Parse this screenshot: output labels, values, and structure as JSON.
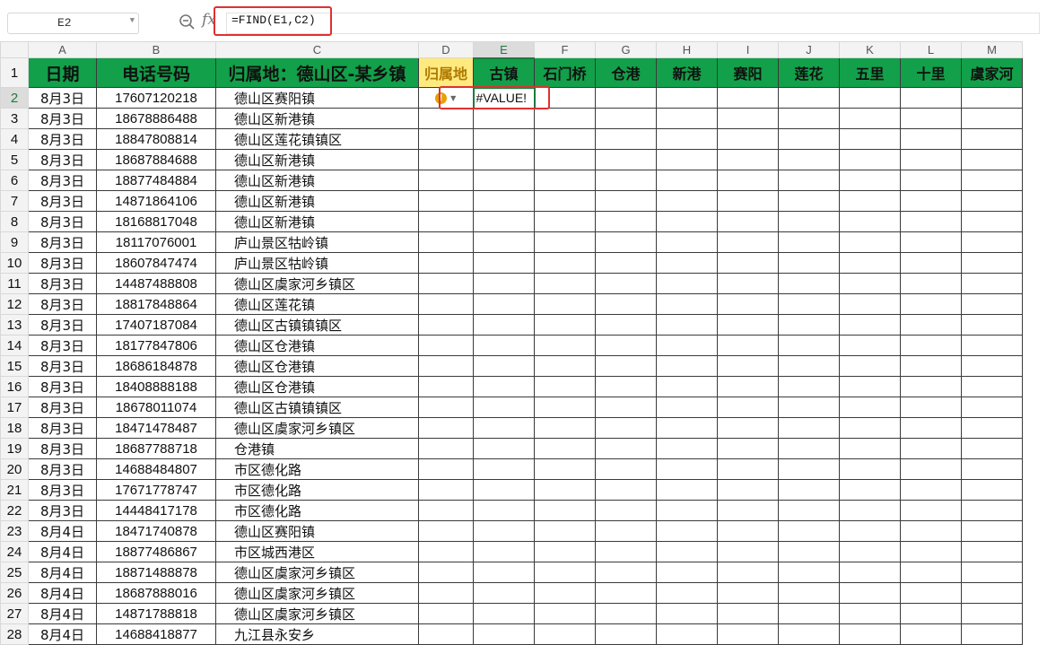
{
  "formula_bar": {
    "name_box": "E2",
    "fx_label": "fx",
    "formula": "=FIND(E1,C2)"
  },
  "columns": [
    "A",
    "B",
    "C",
    "D",
    "E",
    "F",
    "G",
    "H",
    "I",
    "J",
    "K",
    "L",
    "M"
  ],
  "header_row": {
    "row_number": "1",
    "cells": [
      "日期",
      "电话号码",
      "归属地：德山区-某乡镇",
      "归属地",
      "古镇",
      "石门桥",
      "仓港",
      "新港",
      "赛阳",
      "莲花",
      "五里",
      "十里",
      "虞家河"
    ]
  },
  "active_cell": {
    "value": "#VALUE!",
    "warning_icon": "!"
  },
  "rows": [
    {
      "n": "2",
      "date": "8月3日",
      "phone": "17607120218",
      "loc": "德山区赛阳镇"
    },
    {
      "n": "3",
      "date": "8月3日",
      "phone": "18678886488",
      "loc": "德山区新港镇"
    },
    {
      "n": "4",
      "date": "8月3日",
      "phone": "18847808814",
      "loc": "德山区莲花镇镇区"
    },
    {
      "n": "5",
      "date": "8月3日",
      "phone": "18687884688",
      "loc": "德山区新港镇"
    },
    {
      "n": "6",
      "date": "8月3日",
      "phone": "18877484884",
      "loc": "德山区新港镇"
    },
    {
      "n": "7",
      "date": "8月3日",
      "phone": "14871864106",
      "loc": "德山区新港镇"
    },
    {
      "n": "8",
      "date": "8月3日",
      "phone": "18168817048",
      "loc": "德山区新港镇"
    },
    {
      "n": "9",
      "date": "8月3日",
      "phone": "18117076001",
      "loc": "庐山景区牯岭镇"
    },
    {
      "n": "10",
      "date": "8月3日",
      "phone": "18607847474",
      "loc": "庐山景区牯岭镇"
    },
    {
      "n": "11",
      "date": "8月3日",
      "phone": "14487488808",
      "loc": "德山区虞家河乡镇区"
    },
    {
      "n": "12",
      "date": "8月3日",
      "phone": "18817848864",
      "loc": "德山区莲花镇"
    },
    {
      "n": "13",
      "date": "8月3日",
      "phone": "17407187084",
      "loc": "德山区古镇镇镇区"
    },
    {
      "n": "14",
      "date": "8月3日",
      "phone": "18177847806",
      "loc": "德山区仓港镇"
    },
    {
      "n": "15",
      "date": "8月3日",
      "phone": "18686184878",
      "loc": "德山区仓港镇"
    },
    {
      "n": "16",
      "date": "8月3日",
      "phone": "18408888188",
      "loc": "德山区仓港镇"
    },
    {
      "n": "17",
      "date": "8月3日",
      "phone": "18678011074",
      "loc": "德山区古镇镇镇区"
    },
    {
      "n": "18",
      "date": "8月3日",
      "phone": "18471478487",
      "loc": "德山区虞家河乡镇区"
    },
    {
      "n": "19",
      "date": "8月3日",
      "phone": "18687788718",
      "loc": "仓港镇"
    },
    {
      "n": "20",
      "date": "8月3日",
      "phone": "14688484807",
      "loc": "市区德化路"
    },
    {
      "n": "21",
      "date": "8月3日",
      "phone": "17671778747",
      "loc": "市区德化路"
    },
    {
      "n": "22",
      "date": "8月3日",
      "phone": "14448417178",
      "loc": "市区德化路"
    },
    {
      "n": "23",
      "date": "8月4日",
      "phone": "18471740878",
      "loc": "德山区赛阳镇"
    },
    {
      "n": "24",
      "date": "8月4日",
      "phone": "18877486867",
      "loc": "市区城西港区"
    },
    {
      "n": "25",
      "date": "8月4日",
      "phone": "18871488878",
      "loc": "德山区虞家河乡镇区"
    },
    {
      "n": "26",
      "date": "8月4日",
      "phone": "18687888016",
      "loc": "德山区虞家河乡镇区"
    },
    {
      "n": "27",
      "date": "8月4日",
      "phone": "14871788818",
      "loc": "德山区虞家河乡镇区"
    },
    {
      "n": "28",
      "date": "8月4日",
      "phone": "14688418877",
      "loc": "九江县永安乡"
    }
  ],
  "colors": {
    "header_green": "#12a04a",
    "header_yellow": "#ffea80",
    "highlight_red": "#e03030",
    "active_border": "#1e7a3c"
  }
}
